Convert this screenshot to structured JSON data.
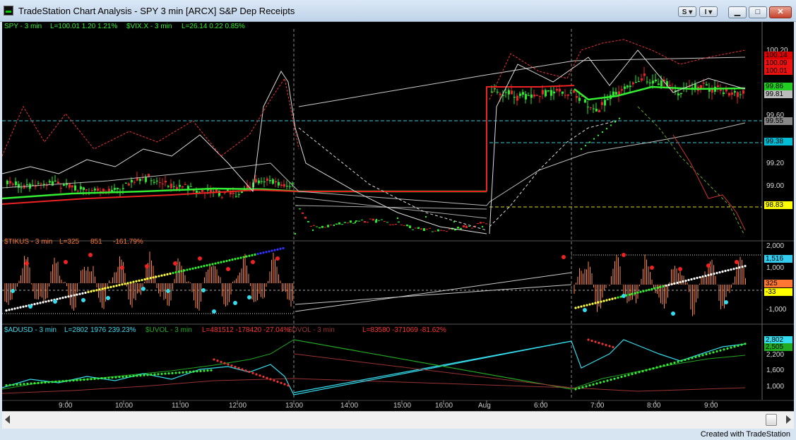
{
  "window": {
    "title": "TradeStation Chart Analysis - SPY  3 min  [ARCX] S&P Dep Receipts",
    "btn_s": "S",
    "btn_i": "I",
    "min": "▁",
    "max": "□",
    "close": "✕"
  },
  "colors": {
    "green": "#22ee22",
    "red": "#ee2222",
    "cyan": "#33ddee",
    "orange": "#ff7733",
    "white": "#dddddd"
  },
  "panel1": {
    "legend": [
      {
        "text": "SPY - 3 min",
        "color": "#33ee33"
      },
      {
        "text": "L=100.01  1.20  1.21%",
        "color": "#33ee33"
      },
      {
        "text": "$VIX.X - 3 min",
        "color": "#33ee33"
      },
      {
        "text": "L=26.14  0.22  0.85%",
        "color": "#33ee33"
      }
    ],
    "axis": [
      "100.20",
      "99.60",
      "99.20",
      "99.00"
    ],
    "badges": [
      {
        "text": "100.14",
        "bg": "#dd0000",
        "fg": "#000000"
      },
      {
        "text": "100.09",
        "bg": "#ee1111",
        "fg": "#000000"
      },
      {
        "text": "100.01",
        "bg": "#ee1111",
        "fg": "#000000"
      },
      {
        "text": "99.86",
        "bg": "#22cc22",
        "fg": "#000000"
      },
      {
        "text": "99.81",
        "bg": "#bbbbbb",
        "fg": "#000000"
      },
      {
        "text": "99.55",
        "bg": "#888888",
        "fg": "#000000"
      },
      {
        "text": "99.38",
        "bg": "#00bcd4",
        "fg": "#000000"
      },
      {
        "text": "98.83",
        "bg": "#ffff00",
        "fg": "#000000"
      }
    ]
  },
  "panel2": {
    "legend": [
      {
        "text": "$TIKUS - 3 min",
        "color": "#ff7733"
      },
      {
        "text": "L=325",
        "color": "#ff7733"
      },
      {
        "text": "851",
        "color": "#ff7733"
      },
      {
        "text": "-161.79%",
        "color": "#ff7733"
      }
    ],
    "axis": [
      "2,000",
      "1,000",
      "-1,000"
    ],
    "badges": [
      {
        "text": "1,516",
        "bg": "#33ccee",
        "fg": "#000000"
      },
      {
        "text": "325",
        "bg": "#ff7733",
        "fg": "#000000"
      },
      {
        "text": "-33",
        "bg": "#ffff00",
        "fg": "#000000"
      }
    ]
  },
  "panel3": {
    "legend": [
      {
        "text": "$ADUSD - 3 min",
        "color": "#33ddee"
      },
      {
        "text": "L=2802",
        "color": "#33ddee"
      },
      {
        "text": "1976  239.23%",
        "color": "#33ddee"
      },
      {
        "text": "$UVOL - 3 min",
        "color": "#22aa22"
      },
      {
        "text": "L=481512  -178420  -27.04%",
        "color": "#ff3333"
      },
      {
        "text": "$DVOL - 3 min",
        "color": "#993333"
      },
      {
        "text": "L=83580  -371069  -81.62%",
        "color": "#ff3333"
      }
    ],
    "axis": [
      "2,200",
      "1,600",
      "1,000"
    ],
    "badges": [
      {
        "text": "2,802",
        "bg": "#33ddee",
        "fg": "#000000"
      },
      {
        "text": "2,505",
        "bg": "#22aa22",
        "fg": "#000000"
      }
    ]
  },
  "xaxis": [
    "9:00",
    "10:00",
    "11:00",
    "12:00",
    "13:00",
    "14:00",
    "15:00",
    "16:00",
    "Aug",
    "6:00",
    "7:00",
    "8:00",
    "9:00"
  ],
  "footer": "Created with TradeStation"
}
